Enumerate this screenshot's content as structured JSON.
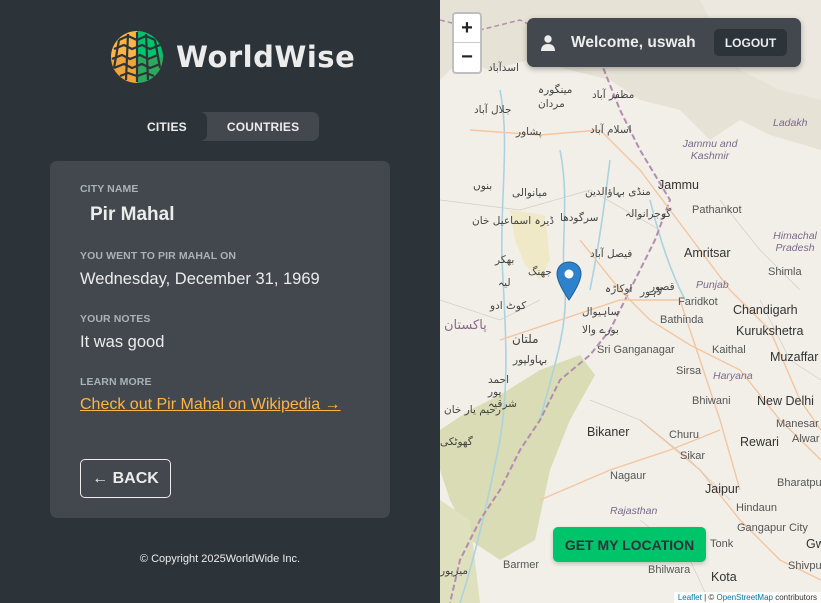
{
  "app": {
    "name": "WorldWise"
  },
  "tabs": [
    {
      "label": "CITIES",
      "active": true
    },
    {
      "label": "COUNTRIES",
      "active": false
    }
  ],
  "city": {
    "name_label": "City name",
    "name": "Pir Mahal",
    "visited_label": "You went to Pir Mahal on",
    "visited_date": "Wednesday, December 31, 1969",
    "notes_label": "Your notes",
    "notes": "It was good",
    "learn_label": "Learn more",
    "wiki_link": "Check out Pir Mahal on Wikipedia →",
    "back_label": "← BACK"
  },
  "footer": {
    "copyright": "© Copyright 2025WorldWide Inc."
  },
  "map": {
    "zoom_in": "+",
    "zoom_out": "−",
    "user": {
      "welcome": "Welcome, uswah",
      "logout": "LOGOUT"
    },
    "location_button": "GET MY LOCATION",
    "attribution": {
      "leaflet": "Leaflet",
      "sep": " | © ",
      "osm": "OpenStreetMap",
      "tail": " contributors"
    },
    "labels": [
      {
        "text": "Jammu",
        "cls": "big"
      },
      {
        "text": "Pathankot",
        "cls": ""
      },
      {
        "text": "Amritsar",
        "cls": "big"
      },
      {
        "text": "Shimla",
        "cls": ""
      },
      {
        "text": "Chandigarh",
        "cls": "big"
      },
      {
        "text": "Kurukshetra",
        "cls": "big"
      },
      {
        "text": "Muzaffar",
        "cls": "big"
      },
      {
        "text": "Bathinda",
        "cls": ""
      },
      {
        "text": "Faridkot",
        "cls": ""
      },
      {
        "text": "Kaithal",
        "cls": ""
      },
      {
        "text": "Sri Ganganagar",
        "cls": ""
      },
      {
        "text": "Sirsa",
        "cls": ""
      },
      {
        "text": "Bhiwani",
        "cls": ""
      },
      {
        "text": "New Delhi",
        "cls": "big"
      },
      {
        "text": "Manesar",
        "cls": ""
      },
      {
        "text": "Rewari",
        "cls": "big"
      },
      {
        "text": "Alwar",
        "cls": ""
      },
      {
        "text": "Churu",
        "cls": ""
      },
      {
        "text": "Bikaner",
        "cls": "big"
      },
      {
        "text": "Sikar",
        "cls": ""
      },
      {
        "text": "Jaipur",
        "cls": "big"
      },
      {
        "text": "Bharatpur",
        "cls": ""
      },
      {
        "text": "Nagaur",
        "cls": ""
      },
      {
        "text": "Hindaun",
        "cls": ""
      },
      {
        "text": "Gangapur City",
        "cls": ""
      },
      {
        "text": "Tonk",
        "cls": ""
      },
      {
        "text": "Barmer",
        "cls": ""
      },
      {
        "text": "Bhilwara",
        "cls": ""
      },
      {
        "text": "Kota",
        "cls": "big"
      },
      {
        "text": "Ladakh",
        "cls": "region"
      },
      {
        "text": "Jammu and Kashmir",
        "cls": "region"
      },
      {
        "text": "Himachal Pradesh",
        "cls": "region"
      },
      {
        "text": "Punjab",
        "cls": "region"
      },
      {
        "text": "Haryana",
        "cls": "region"
      },
      {
        "text": "Rajasthan",
        "cls": "region"
      },
      {
        "text": "Gw",
        "cls": "big"
      },
      {
        "text": "Shivpu",
        "cls": ""
      },
      {
        "text": "پاکستان",
        "cls": "urdu"
      },
      {
        "text": "ملتان",
        "cls": "urdu"
      },
      {
        "text": "لاہور",
        "cls": "urdu"
      },
      {
        "text": "فیصل آباد",
        "cls": "urdu"
      },
      {
        "text": "اسلام آباد",
        "cls": "urdu"
      },
      {
        "text": "پشاور",
        "cls": "urdu"
      },
      {
        "text": "گوجرانوالہ",
        "cls": "urdu"
      },
      {
        "text": "سرگودھا",
        "cls": "urdu"
      },
      {
        "text": "جھنگ",
        "cls": "urdu"
      },
      {
        "text": "ساہیوال",
        "cls": "urdu"
      },
      {
        "text": "بہاولپور",
        "cls": "urdu"
      },
      {
        "text": "رحیم یار خان",
        "cls": "urdu"
      },
      {
        "text": "میرپور",
        "cls": "urdu"
      },
      {
        "text": "اوکاڑہ",
        "cls": "urdu"
      },
      {
        "text": "قصور",
        "cls": "urdu"
      },
      {
        "text": "بنوں",
        "cls": "urdu"
      },
      {
        "text": "میانوالی",
        "cls": "urdu"
      },
      {
        "text": "ڈیرہ اسماعیل خان",
        "cls": "urdu"
      },
      {
        "text": "مردان",
        "cls": "urdu"
      },
      {
        "text": "مظفر آباد",
        "cls": "urdu"
      },
      {
        "text": "کوٹ ادو",
        "cls": "urdu"
      },
      {
        "text": "منڈی بہاؤالدین",
        "cls": "urdu"
      },
      {
        "text": "بھکر",
        "cls": "urdu"
      },
      {
        "text": "لیہ",
        "cls": "urdu"
      },
      {
        "text": "احمد پور شرقیہ",
        "cls": "urdu"
      },
      {
        "text": "بورے والا",
        "cls": "urdu"
      },
      {
        "text": "جلال آباد",
        "cls": "urdu"
      },
      {
        "text": "مینگورہ",
        "cls": "urdu"
      },
      {
        "text": "اسدآباد",
        "cls": "urdu"
      },
      {
        "text": "گھوٹکی",
        "cls": "urdu"
      }
    ]
  }
}
